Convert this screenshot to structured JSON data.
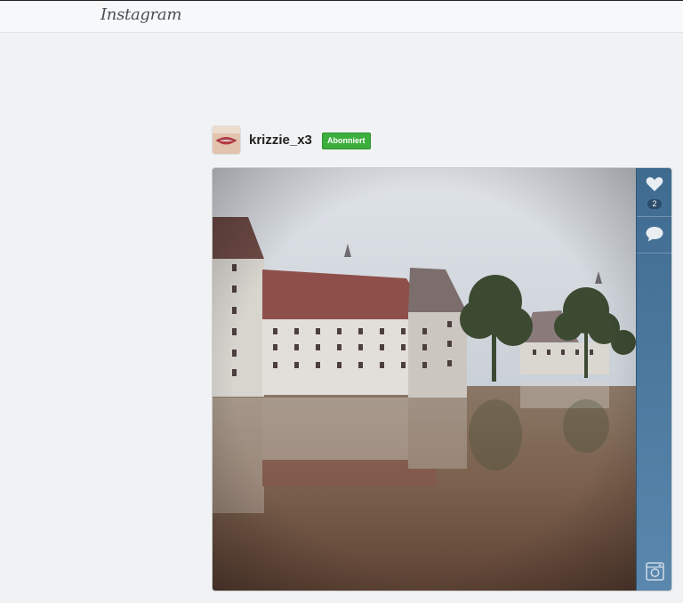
{
  "header": {
    "logo_text": "Instagram"
  },
  "post": {
    "username": "krizzie_x3",
    "follow_status": "Abonniert",
    "likes": "2"
  },
  "icons": {
    "like": "heart-icon",
    "comment": "comment-icon",
    "camera": "camera-icon"
  },
  "colors": {
    "sidebar": "#4a779c",
    "follow_badge": "#3cae3c"
  }
}
